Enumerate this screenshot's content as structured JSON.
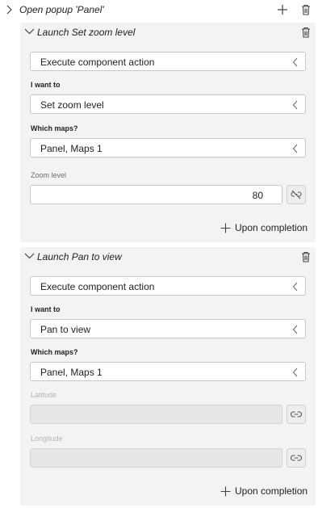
{
  "top": {
    "title": "Open popup 'Panel'"
  },
  "blocks": [
    {
      "title": "Launch Set zoom level",
      "action": "Execute component action",
      "i_want_to_label": "I want to",
      "i_want_to_value": "Set zoom level",
      "which_maps_label": "Which maps?",
      "which_maps_value": "Panel, Maps 1",
      "zoom_label": "Zoom level",
      "zoom_value": "80",
      "upon_completion": "Upon completion"
    },
    {
      "title": "Launch Pan to view",
      "action": "Execute component action",
      "i_want_to_label": "I want to",
      "i_want_to_value": "Pan to view",
      "which_maps_label": "Which maps?",
      "which_maps_value": "Panel, Maps 1",
      "latitude_label": "Latitude",
      "longitude_label": "Longitude",
      "upon_completion": "Upon completion"
    }
  ]
}
